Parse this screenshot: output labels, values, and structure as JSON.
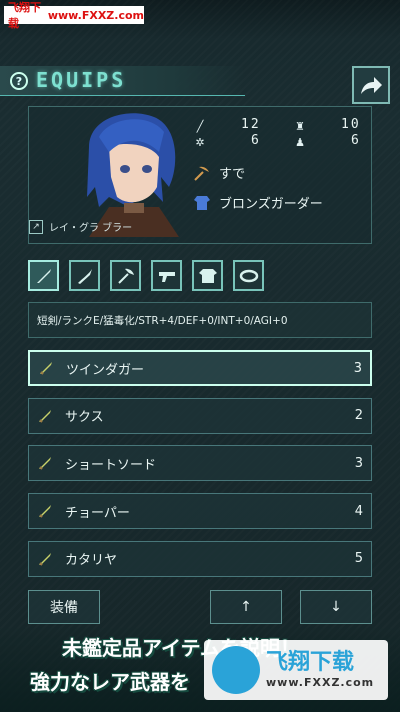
{
  "watermark_top": {
    "text": "飞翔下载",
    "url": "www.FXXZ.com"
  },
  "header": {
    "help": "?",
    "title": "EQUIPS"
  },
  "stats": {
    "atk": "12",
    "def": "10",
    "mag": "6",
    "agi": "6"
  },
  "equipped": {
    "weapon": "すで",
    "armor": "ブロンズガーダー"
  },
  "character": {
    "name": "レイ・グラ ブラー"
  },
  "categories": [
    {
      "icon": "dagger-icon"
    },
    {
      "icon": "sword-icon"
    },
    {
      "icon": "axe-icon"
    },
    {
      "icon": "gun-icon"
    },
    {
      "icon": "shirt-icon"
    },
    {
      "icon": "ring-icon"
    }
  ],
  "description": "短剣/ランクE/猛毒化/STR+4/DEF+0/INT+0/AGI+0",
  "items": [
    {
      "name": "ツインダガー",
      "count": "3"
    },
    {
      "name": "サクス",
      "count": "2"
    },
    {
      "name": "ショートソード",
      "count": "3"
    },
    {
      "name": "チョーパー",
      "count": "4"
    },
    {
      "name": "カタリヤ",
      "count": "5"
    }
  ],
  "buttons": {
    "equip": "装備",
    "up": "↑",
    "down": "↓"
  },
  "banner": {
    "line1": "未鑑定品アイテムを説明！",
    "line2": "強力なレア武器を"
  },
  "watermark_bottom": {
    "title": "飞翔下载",
    "url": "www.FXXZ.com"
  },
  "colors": {
    "accent": "#7de0d0",
    "border": "#48777a",
    "selected_border": "#cceeee"
  }
}
